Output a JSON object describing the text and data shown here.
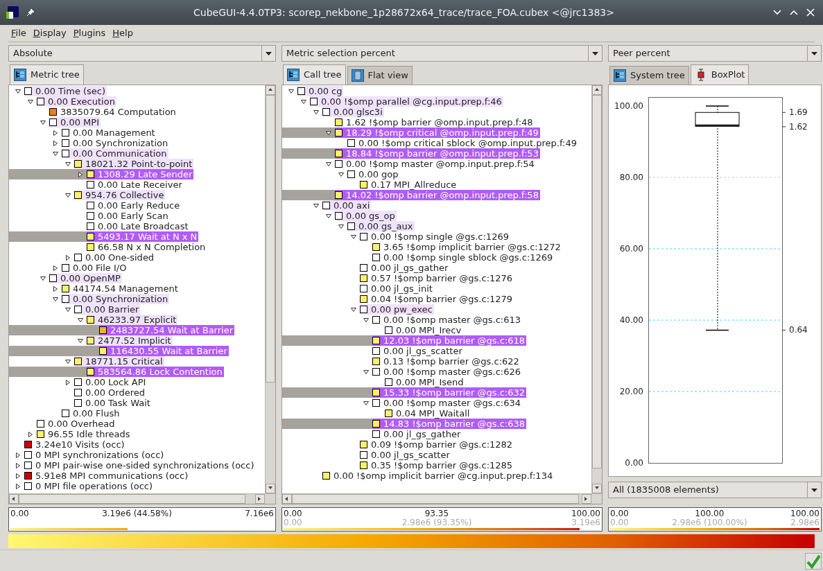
{
  "window": {
    "title": "CubeGUI-4.4.0TP3: scorep_nekbone_1p28672x64_trace/trace_FOA.cubex <@jrc1383>"
  },
  "menu": [
    "File",
    "Display",
    "Plugins",
    "Help"
  ],
  "panels": [
    {
      "dropdown": "Absolute",
      "tabs": [
        {
          "label": "Metric tree",
          "selected": true
        }
      ],
      "tree": [
        {
          "label": "0.00 Time (sec)",
          "color": "#ffffff",
          "expanded": true,
          "marked": true,
          "selected": false,
          "children": [
            {
              "label": "0.00 Execution",
              "color": "#ffffff",
              "expanded": true,
              "marked": true,
              "selected": false,
              "children": [
                {
                  "label": "3835079.64 Computation",
                  "color": "#e8820c",
                  "marked": false,
                  "selected": false
                },
                {
                  "label": "0.00 MPI",
                  "color": "#ffffff",
                  "expanded": true,
                  "marked": true,
                  "selected": false,
                  "children": [
                    {
                      "label": "0.00 Management",
                      "color": "#ffffff",
                      "expanded": false,
                      "marked": false,
                      "selected": false
                    },
                    {
                      "label": "0.00 Synchronization",
                      "color": "#ffffff",
                      "expanded": false,
                      "marked": false,
                      "selected": false
                    },
                    {
                      "label": "0.00 Communication",
                      "color": "#ffffff",
                      "expanded": true,
                      "marked": true,
                      "selected": false,
                      "children": [
                        {
                          "label": "18021.32 Point-to-point",
                          "color": "#fdf06a",
                          "expanded": true,
                          "marked": true,
                          "selected": false,
                          "children": [
                            {
                              "label": "1308.29 Late Sender",
                              "color": "#fdf06a",
                              "expanded": false,
                              "selected": true
                            },
                            {
                              "label": "0.00 Late Receiver",
                              "color": "#ffffff",
                              "marked": false,
                              "selected": false
                            }
                          ]
                        },
                        {
                          "label": "954.76 Collective",
                          "color": "#fdf06a",
                          "expanded": true,
                          "marked": true,
                          "selected": false,
                          "children": [
                            {
                              "label": "0.00 Early Reduce",
                              "color": "#ffffff",
                              "marked": false,
                              "selected": false
                            },
                            {
                              "label": "0.00 Early Scan",
                              "color": "#ffffff",
                              "marked": false,
                              "selected": false
                            },
                            {
                              "label": "0.00 Late Broadcast",
                              "color": "#ffffff",
                              "marked": false,
                              "selected": false
                            },
                            {
                              "label": "5493.17 Wait at N x N",
                              "color": "#fdf06a",
                              "selected": true
                            },
                            {
                              "label": "66.58 N x N Completion",
                              "color": "#fdf06a",
                              "marked": false,
                              "selected": false
                            }
                          ]
                        },
                        {
                          "label": "0.00 One-sided",
                          "color": "#ffffff",
                          "expanded": false,
                          "marked": false,
                          "selected": false
                        }
                      ]
                    },
                    {
                      "label": "0.00 File I/O",
                      "color": "#ffffff",
                      "expanded": false,
                      "marked": false,
                      "selected": false
                    }
                  ]
                },
                {
                  "label": "0.00 OpenMP",
                  "color": "#ffffff",
                  "expanded": true,
                  "marked": true,
                  "selected": false,
                  "children": [
                    {
                      "label": "44174.54 Management",
                      "color": "#fdf06a",
                      "expanded": false,
                      "marked": false,
                      "selected": false
                    },
                    {
                      "label": "0.00 Synchronization",
                      "color": "#ffffff",
                      "expanded": true,
                      "marked": true,
                      "selected": false,
                      "children": [
                        {
                          "label": "0.00 Barrier",
                          "color": "#ffffff",
                          "expanded": true,
                          "marked": true,
                          "selected": false,
                          "children": [
                            {
                              "label": "46233.97 Explicit",
                              "color": "#fdf06a",
                              "expanded": true,
                              "marked": true,
                              "selected": false,
                              "children": [
                                {
                                  "label": "2483727.54 Wait at Barrier",
                                  "color": "#f0b030",
                                  "selected": true
                                }
                              ]
                            },
                            {
                              "label": "2477.52 Implicit",
                              "color": "#fdf06a",
                              "expanded": true,
                              "marked": true,
                              "selected": false,
                              "children": [
                                {
                                  "label": "116430.55 Wait at Barrier",
                                  "color": "#fdf06a",
                                  "selected": true
                                }
                              ]
                            }
                          ]
                        },
                        {
                          "label": "18771.15 Critical",
                          "color": "#fdf06a",
                          "expanded": true,
                          "marked": true,
                          "selected": false,
                          "children": [
                            {
                              "label": "583564.86 Lock Contention",
                              "color": "#fdf06a",
                              "selected": true
                            }
                          ]
                        },
                        {
                          "label": "0.00 Lock API",
                          "color": "#ffffff",
                          "expanded": false,
                          "marked": false,
                          "selected": false
                        },
                        {
                          "label": "0.00 Ordered",
                          "color": "#ffffff",
                          "marked": false,
                          "selected": false
                        },
                        {
                          "label": "0.00 Task Wait",
                          "color": "#ffffff",
                          "marked": false,
                          "selected": false
                        }
                      ]
                    },
                    {
                      "label": "0.00 Flush",
                      "color": "#ffffff",
                      "marked": false,
                      "selected": false
                    }
                  ]
                }
              ]
            },
            {
              "label": "0.00 Overhead",
              "color": "#ffffff",
              "marked": false,
              "selected": false
            },
            {
              "label": "96.55 Idle threads",
              "color": "#fdf06a",
              "expanded": false,
              "marked": false,
              "selected": false
            }
          ]
        },
        {
          "label": "3.24e10 Visits (occ)",
          "color": "#cc0000",
          "marked": false,
          "selected": false
        },
        {
          "label": "0 MPI synchronizations (occ)",
          "color": "#ffffff",
          "expanded": false,
          "marked": false,
          "selected": false
        },
        {
          "label": "0 MPI pair-wise one-sided synchronizations (occ)",
          "color": "#ffffff",
          "expanded": false,
          "marked": false,
          "selected": false
        },
        {
          "label": "5.91e8 MPI communications (occ)",
          "color": "#cc0000",
          "expanded": false,
          "marked": false,
          "selected": false
        },
        {
          "label": "0 MPI file operations (occ)",
          "color": "#ffffff",
          "expanded": false,
          "marked": false,
          "selected": false
        }
      ],
      "value_bar": {
        "min": "0.00",
        "value": "3.19e6 (44.58%)",
        "max": "7.16e6",
        "level": 0.4458
      }
    },
    {
      "dropdown": "Metric selection percent",
      "tabs": [
        {
          "label": "Call tree",
          "selected": true
        },
        {
          "label": "Flat view",
          "selected": false
        }
      ],
      "tree": [
        {
          "label": "0.00 cg",
          "color": "#ffffff",
          "expanded": true,
          "marked": true,
          "selected": false,
          "children": [
            {
              "label": "0.00 !$omp parallel @cg.input.prep.f:46",
              "color": "#ffffff",
              "expanded": true,
              "marked": true,
              "selected": false,
              "children": [
                {
                  "label": "0.00 glsc3i",
                  "color": "#ffffff",
                  "expanded": true,
                  "marked": true,
                  "selected": false,
                  "children": [
                    {
                      "label": "1.62 !$omp barrier @omp.input.prep.f:48",
                      "color": "#fdf06a",
                      "marked": false,
                      "selected": false
                    },
                    {
                      "label": "18.29 !$omp critical @omp.input.prep.f:49",
                      "color": "#fdf06a",
                      "expanded": true,
                      "selected": true,
                      "children": [
                        {
                          "label": "0.00 !$omp critical sblock @omp.input.prep.f:49",
                          "color": "#ffffff",
                          "marked": false,
                          "selected": false
                        }
                      ]
                    },
                    {
                      "label": "18.84 !$omp barrier @omp.input.prep.f:53",
                      "color": "#fdf06a",
                      "selected": true
                    },
                    {
                      "label": "0.00 !$omp master @omp.input.prep.f:54",
                      "color": "#ffffff",
                      "expanded": true,
                      "marked": false,
                      "selected": false,
                      "children": [
                        {
                          "label": "0.00 gop",
                          "color": "#ffffff",
                          "expanded": true,
                          "marked": false,
                          "selected": false,
                          "children": [
                            {
                              "label": "0.17 MPI_Allreduce",
                              "color": "#fdf06a",
                              "marked": false,
                              "selected": false
                            }
                          ]
                        }
                      ]
                    },
                    {
                      "label": "14.02 !$omp barrier @omp.input.prep.f:58",
                      "color": "#fdf06a",
                      "selected": true
                    }
                  ]
                },
                {
                  "label": "0.00 axi",
                  "color": "#ffffff",
                  "expanded": true,
                  "marked": true,
                  "selected": false,
                  "children": [
                    {
                      "label": "0.00 gs_op",
                      "color": "#ffffff",
                      "expanded": true,
                      "marked": true,
                      "selected": false,
                      "children": [
                        {
                          "label": "0.00 gs_aux",
                          "color": "#ffffff",
                          "expanded": true,
                          "marked": true,
                          "selected": false,
                          "children": [
                            {
                              "label": "0.00 !$omp single @gs.c:1269",
                              "color": "#ffffff",
                              "expanded": true,
                              "marked": false,
                              "selected": false,
                              "children": [
                                {
                                  "label": "3.65 !$omp implicit barrier @gs.c:1272",
                                  "color": "#fdf06a",
                                  "marked": false,
                                  "selected": false
                                },
                                {
                                  "label": "0.00 !$omp single sblock @gs.c:1269",
                                  "color": "#ffffff",
                                  "marked": false,
                                  "selected": false
                                }
                              ]
                            },
                            {
                              "label": "0.00 jl_gs_gather",
                              "color": "#ffffff",
                              "marked": false,
                              "selected": false
                            },
                            {
                              "label": "0.57 !$omp barrier @gs.c:1276",
                              "color": "#fdf06a",
                              "marked": false,
                              "selected": false
                            },
                            {
                              "label": "0.00 jl_gs_init",
                              "color": "#ffffff",
                              "marked": false,
                              "selected": false
                            },
                            {
                              "label": "0.04 !$omp barrier @gs.c:1279",
                              "color": "#fdf06a",
                              "marked": false,
                              "selected": false
                            },
                            {
                              "label": "0.00 pw_exec",
                              "color": "#ffffff",
                              "expanded": true,
                              "marked": true,
                              "selected": false,
                              "children": [
                                {
                                  "label": "0.00 !$omp master @gs.c:613",
                                  "color": "#ffffff",
                                  "expanded": true,
                                  "marked": false,
                                  "selected": false,
                                  "children": [
                                    {
                                      "label": "0.00 MPI_Irecv",
                                      "color": "#ffffff",
                                      "marked": false,
                                      "selected": false
                                    }
                                  ]
                                },
                                {
                                  "label": "12.03 !$omp barrier @gs.c:618",
                                  "color": "#fdf06a",
                                  "selected": true
                                },
                                {
                                  "label": "0.00 jl_gs_scatter",
                                  "color": "#ffffff",
                                  "marked": false,
                                  "selected": false
                                },
                                {
                                  "label": "0.13 !$omp barrier @gs.c:622",
                                  "color": "#fdf06a",
                                  "marked": false,
                                  "selected": false
                                },
                                {
                                  "label": "0.00 !$omp master @gs.c:626",
                                  "color": "#ffffff",
                                  "expanded": true,
                                  "marked": false,
                                  "selected": false,
                                  "children": [
                                    {
                                      "label": "0.00 MPI_Isend",
                                      "color": "#ffffff",
                                      "marked": false,
                                      "selected": false
                                    }
                                  ]
                                },
                                {
                                  "label": "15.33 !$omp barrier @gs.c:632",
                                  "color": "#fdf06a",
                                  "selected": true
                                },
                                {
                                  "label": "0.00 !$omp master @gs.c:634",
                                  "color": "#ffffff",
                                  "expanded": true,
                                  "marked": false,
                                  "selected": false,
                                  "children": [
                                    {
                                      "label": "0.04 MPI_Waitall",
                                      "color": "#fdf06a",
                                      "marked": false,
                                      "selected": false
                                    }
                                  ]
                                },
                                {
                                  "label": "14.83 !$omp barrier @gs.c:638",
                                  "color": "#fdf06a",
                                  "selected": true
                                },
                                {
                                  "label": "0.00 jl_gs_gather",
                                  "color": "#ffffff",
                                  "marked": false,
                                  "selected": false
                                }
                              ]
                            },
                            {
                              "label": "0.09 !$omp barrier @gs.c:1282",
                              "color": "#fdf06a",
                              "marked": false,
                              "selected": false
                            },
                            {
                              "label": "0.00 jl_gs_scatter",
                              "color": "#ffffff",
                              "marked": false,
                              "selected": false
                            },
                            {
                              "label": "0.35 !$omp barrier @gs.c:1285",
                              "color": "#fdf06a",
                              "marked": false,
                              "selected": false
                            }
                          ]
                        }
                      ]
                    }
                  ]
                },
                {
                  "label": "0.00 !$omp implicit barrier @cg.input.prep.f:134",
                  "color": "#fdf06a",
                  "marked": false,
                  "selected": false
                }
              ]
            }
          ]
        }
      ],
      "value_bar": {
        "min": "0.00",
        "value": "93.35",
        "max": "100.00",
        "min_abs": "0.00",
        "value_abs": "2.98e6 (93.35%)",
        "max_abs": "3.19e6",
        "level": 0.9335
      }
    },
    {
      "dropdown": "Peer percent",
      "tabs": [
        {
          "label": "System tree",
          "selected": false
        },
        {
          "label": "BoxPlot",
          "selected": true
        }
      ],
      "boxplot": {
        "y_labels": [
          "100.00",
          "80.00",
          "60.00",
          "40.00",
          "20.00",
          "0.00"
        ],
        "side_labels": [
          "1.69",
          "1.62",
          "0.64"
        ]
      },
      "filter": "All (1835008 elements)",
      "value_bar": {
        "min": "0.00",
        "value": "100.00",
        "max": "100.00",
        "min_abs": "0.00",
        "value_abs": "2.98e6 (100.00%)",
        "max_abs": "2.98e6",
        "level": 1
      }
    }
  ]
}
